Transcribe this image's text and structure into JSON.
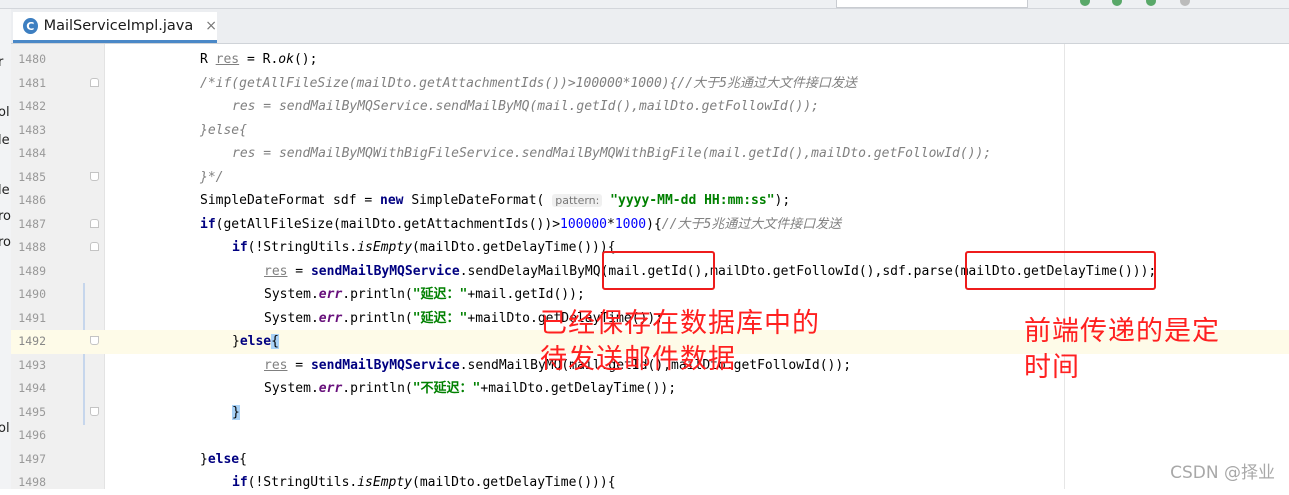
{
  "editor_tab": {
    "icon_letter": "C",
    "label": "MailServiceImpl.java",
    "close": "×"
  },
  "left_strip_fragments": [
    "r",
    "ol",
    "le",
    "le",
    "ro",
    "ro",
    "ol"
  ],
  "line_numbers": [
    "1480",
    "1481",
    "1482",
    "1483",
    "1484",
    "1485",
    "1486",
    "1487",
    "1488",
    "1489",
    "1490",
    "1491",
    "1492",
    "1493",
    "1494",
    "1495",
    "1496",
    "1497",
    "1498"
  ],
  "code": {
    "l1480": {
      "a": "R ",
      "b": "res",
      "c": " = R.",
      "d": "ok",
      "e": "();"
    },
    "l1481": "/*if(getAllFileSize(mailDto.getAttachmentIds())>100000*1000){//大于5兆通过大文件接口发送",
    "l1482": "res = sendMailByMQService.sendMailByMQ(mail.getId(),mailDto.getFollowId());",
    "l1483": "}else{",
    "l1484": "res = sendMailByMQWithBigFileService.sendMailByMQWithBigFile(mail.getId(),mailDto.getFollowId());",
    "l1485": "}*/",
    "l1486": {
      "a": "SimpleDateFormat sdf = ",
      "kw": "new",
      "b": " SimpleDateFormat( ",
      "hint": "pattern:",
      "str": "\"yyyy-MM-dd HH:mm:ss\"",
      "c": ");"
    },
    "l1487": {
      "kw": "if",
      "a": "(getAllFileSize(mailDto.getAttachmentIds())>",
      "n1": "100000",
      "op": "*",
      "n2": "1000",
      "b": "){",
      "cm": "//大于5兆通过大文件接口发送"
    },
    "l1488": {
      "kw": "if",
      "a": "(!StringUtils.",
      "it": "isEmpty",
      "b": "(mailDto.getDelayTime())){"
    },
    "l1489": {
      "v": "res",
      "a": " = ",
      "svc": "sendMailByMQService",
      "b": ".sendDelayMailByMQ(mail.getId(),mailDto.getFollowId(),sdf.parse(mailDto.getDelayTime()));"
    },
    "l1490": {
      "a": "System.",
      "fld": "err",
      "b": ".println(",
      "str": "\"延迟：\"",
      "c": "+mail.getId());"
    },
    "l1491": {
      "a": "System.",
      "fld": "err",
      "b": ".println(",
      "str": "\"延迟：\"",
      "c": "+mailDto.getDelayTime());"
    },
    "l1492": {
      "a": "}",
      "kw": "else",
      "b": "{"
    },
    "l1493": {
      "v": "res",
      "a": " = ",
      "svc": "sendMailByMQService",
      "b": ".sendMailByMQ(mail.getId(),mailDto.getFollowId());"
    },
    "l1494": {
      "a": "System.",
      "fld": "err",
      "b": ".println(",
      "str": "\"不延迟：\"",
      "c": "+mailDto.getDelayTime());"
    },
    "l1495": "}",
    "l1496": "",
    "l1497": {
      "a": "}",
      "kw": "else",
      "b": "{"
    },
    "l1498": {
      "kw": "if",
      "a": "(!StringUtils.",
      "it": "isEmpty",
      "b": "(mailDto.getDelayTime())){"
    }
  },
  "annotations": {
    "saved_data": [
      "已经保存在数据库中的",
      "待发送邮件数据"
    ],
    "frontend_time": [
      "前端传递的是定",
      "时间"
    ]
  },
  "watermark": "CSDN @择业",
  "colors": {
    "annotation_red": "#ff2020",
    "keyword": "#000080",
    "string": "#008000",
    "comment": "#808080",
    "field": "#660e7a"
  }
}
